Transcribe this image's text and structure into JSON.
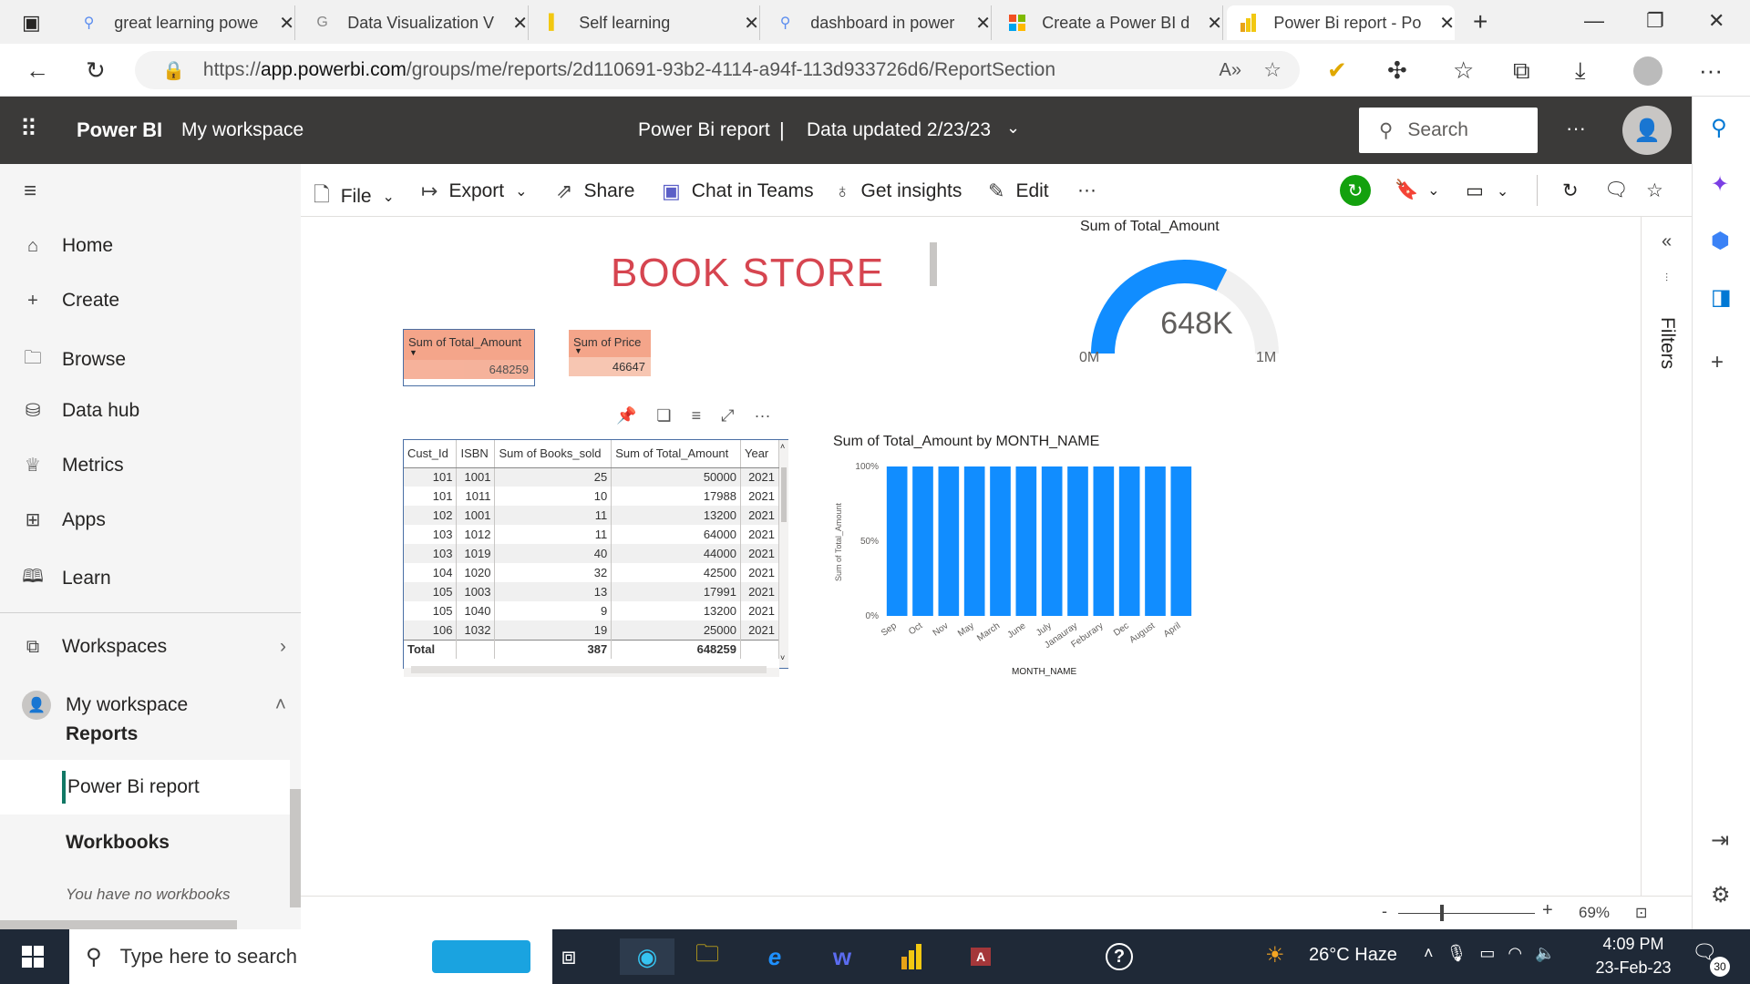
{
  "browser": {
    "tabs": [
      {
        "title": "great learning powe",
        "icon": "search-icon"
      },
      {
        "title": "Data Visualization V",
        "icon": "google-icon"
      },
      {
        "title": "Self learning",
        "icon": "bookmark-icon"
      },
      {
        "title": "dashboard in power",
        "icon": "search-icon"
      },
      {
        "title": "Create a Power BI d",
        "icon": "microsoft-icon"
      },
      {
        "title": "Power Bi report - Po",
        "icon": "powerbi-icon"
      }
    ],
    "url_prefix": "https://",
    "url_host": "app.powerbi.com",
    "url_path": "/groups/me/reports/2d110691-93b2-4114-a94f-113d933726d6/ReportSection"
  },
  "header": {
    "brand": "Power BI",
    "workspace": "My workspace",
    "report_name": "Power Bi report",
    "separator": "|",
    "data_updated": "Data updated 2/23/23",
    "search_placeholder": "Search",
    "more": "···"
  },
  "nav": {
    "items": [
      {
        "label": "Home",
        "icon": "home-icon"
      },
      {
        "label": "Create",
        "icon": "plus-icon"
      },
      {
        "label": "Browse",
        "icon": "folder-icon"
      },
      {
        "label": "Data hub",
        "icon": "database-icon"
      },
      {
        "label": "Metrics",
        "icon": "trophy-icon"
      },
      {
        "label": "Apps",
        "icon": "apps-icon"
      },
      {
        "label": "Learn",
        "icon": "book-icon"
      }
    ],
    "workspaces": "Workspaces",
    "my_workspace": "My workspace",
    "reports_heading": "Reports",
    "report_item": "Power Bi report",
    "workbooks_heading": "Workbooks",
    "workbooks_empty": "You have no workbooks"
  },
  "toolbar": {
    "file": "File",
    "export": "Export",
    "share": "Share",
    "chat": "Chat in Teams",
    "insights": "Get insights",
    "edit": "Edit",
    "more": "···"
  },
  "report": {
    "title": "BOOK STORE",
    "card1": {
      "label": "Sum of Total_Amount",
      "value": "648259"
    },
    "card2": {
      "label": "Sum of Price",
      "value": "46647"
    },
    "gauge": {
      "title": "Sum of Total_Amount",
      "value_label": "648K",
      "min_label": "0M",
      "max_label": "1M",
      "fraction": 0.648
    },
    "table": {
      "columns": [
        "Cust_Id",
        "ISBN",
        "Sum of Books_sold",
        "Sum of Total_Amount",
        "Year"
      ],
      "rows": [
        [
          "101",
          "1001",
          "25",
          "50000",
          "2021"
        ],
        [
          "101",
          "1011",
          "10",
          "17988",
          "2021"
        ],
        [
          "102",
          "1001",
          "11",
          "13200",
          "2021"
        ],
        [
          "103",
          "1012",
          "11",
          "64000",
          "2021"
        ],
        [
          "103",
          "1019",
          "40",
          "44000",
          "2021"
        ],
        [
          "104",
          "1020",
          "32",
          "42500",
          "2021"
        ],
        [
          "105",
          "1003",
          "13",
          "17991",
          "2021"
        ],
        [
          "105",
          "1040",
          "9",
          "13200",
          "2021"
        ],
        [
          "106",
          "1032",
          "19",
          "25000",
          "2021"
        ]
      ],
      "total_label": "Total",
      "total_books": "387",
      "total_amount": "648259"
    }
  },
  "chart_data": {
    "type": "bar",
    "title": "Sum of Total_Amount by MONTH_NAME",
    "xlabel": "MONTH_NAME",
    "ylabel": "Sum of Total_Amount",
    "categories": [
      "Sep",
      "Oct",
      "Nov",
      "May",
      "March",
      "June",
      "July",
      "Janauray",
      "Feburary",
      "Dec",
      "August",
      "April"
    ],
    "values": [
      100,
      100,
      100,
      100,
      100,
      100,
      100,
      100,
      100,
      100,
      100,
      100
    ],
    "y_ticks": [
      "100%",
      "50%",
      "0%"
    ],
    "ylim": [
      0,
      100
    ],
    "color": "#118dff"
  },
  "filters": {
    "label": "Filters"
  },
  "zoom": {
    "level": "69%",
    "minus": "-",
    "plus": "+"
  },
  "taskbar": {
    "search_placeholder": "Type here to search",
    "weather": "26°C  Haze",
    "time": "4:09 PM",
    "date": "23-Feb-23",
    "notification_count": "30"
  }
}
